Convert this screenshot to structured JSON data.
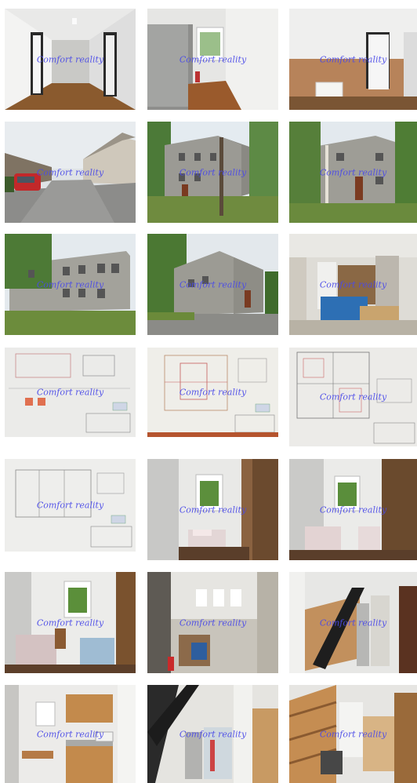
{
  "gallery": {
    "watermark": "Comfort reality",
    "photos": [
      {
        "subject": "corridor",
        "watermark": "Comfort reality"
      },
      {
        "subject": "hallway-window",
        "watermark": "Comfort reality"
      },
      {
        "subject": "entrance-hall",
        "watermark": "Comfort reality"
      },
      {
        "subject": "street-view",
        "watermark": "Comfort reality"
      },
      {
        "subject": "building-exterior-trees",
        "watermark": "Comfort reality"
      },
      {
        "subject": "building-exterior-birch",
        "watermark": "Comfort reality"
      },
      {
        "subject": "building-front",
        "watermark": "Comfort reality"
      },
      {
        "subject": "building-side",
        "watermark": "Comfort reality"
      },
      {
        "subject": "storage-room",
        "watermark": "Comfort reality"
      },
      {
        "subject": "floor-plan",
        "watermark": "Comfort reality"
      },
      {
        "subject": "floor-plan",
        "watermark": "Comfort reality"
      },
      {
        "subject": "floor-plan",
        "watermark": "Comfort reality"
      },
      {
        "subject": "floor-plan",
        "watermark": "Comfort reality"
      },
      {
        "subject": "bedroom",
        "watermark": "Comfort reality"
      },
      {
        "subject": "bedroom",
        "watermark": "Comfort reality"
      },
      {
        "subject": "bedroom",
        "watermark": "Comfort reality"
      },
      {
        "subject": "renovation-room",
        "watermark": "Comfort reality"
      },
      {
        "subject": "staircase",
        "watermark": "Comfort reality"
      },
      {
        "subject": "kitchenette",
        "watermark": "Comfort reality"
      },
      {
        "subject": "boiler-room",
        "watermark": "Comfort reality"
      },
      {
        "subject": "stair-hall",
        "watermark": "Comfort reality"
      }
    ]
  }
}
